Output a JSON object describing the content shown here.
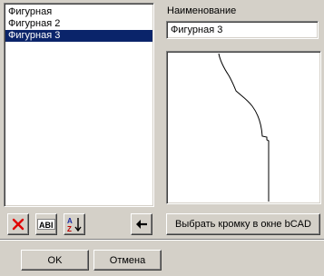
{
  "profiles_list": {
    "items": [
      {
        "label": "Фигурная",
        "selected": false
      },
      {
        "label": "Фигурная 2",
        "selected": false
      },
      {
        "label": "Фигурная 3",
        "selected": true
      }
    ]
  },
  "name_field": {
    "label": "Наименование",
    "value": "Фигурная 3"
  },
  "toolbar": {
    "delete_icon": "delete-x-icon",
    "rename_icon": "rename-abi-icon",
    "sort_icon": "sort-az-icon",
    "back_arrow_icon": "arrow-left-icon",
    "pick_edge_label": "Выбрать кромку в окне bCAD"
  },
  "dialog_buttons": {
    "ok_label": "OK",
    "cancel_label": "Отмена"
  },
  "colors": {
    "selection": "#0a246a",
    "delete_red": "#e00000",
    "sort_blue": "#1a2aa0"
  }
}
